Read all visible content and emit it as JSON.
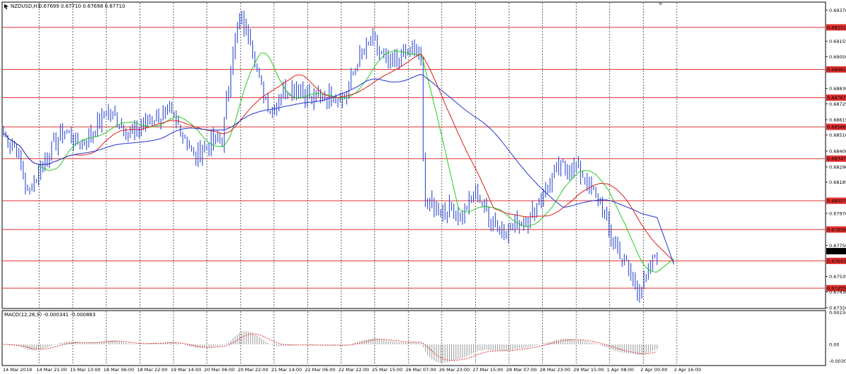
{
  "chart_header": {
    "symbol_timeframe": "NZDUSD,H1",
    "ohlc": "0.67699 0.67710 0.67698 0.67710",
    "icon": "chart-arrow-icon"
  },
  "macd_header": {
    "label": "MACD(12,26,9) -0.000341 -0.000883"
  },
  "colors": {
    "candles": "#2e4bd1",
    "ma_fast": "#22cc22",
    "ma_mid": "#e01b1b",
    "ma_slow": "#2233cc",
    "levels": "#e03030",
    "grid": "#000000",
    "macd_hist": "#9a9a9a",
    "macd_signal": "#e03030"
  },
  "chart_data": {
    "type": "line",
    "price_axis": {
      "ticks": [
        "0.69370",
        "0.69155",
        "0.69050",
        "0.68830",
        "0.68725",
        "0.68615",
        "0.68510",
        "0.68400",
        "0.68290",
        "0.68185",
        "0.67970",
        "0.67750",
        "0.67535",
        "0.67430",
        "0.67320"
      ],
      "ylim": [
        0.6732,
        0.6942
      ],
      "current_price": "0.67710"
    },
    "horizontal_levels": [
      "0.69251",
      "0.68961",
      "0.68767",
      "0.68566",
      "0.68347",
      "0.68057",
      "0.67859",
      "0.67643",
      "0.67455"
    ],
    "time_axis": [
      "14 Mar 2019",
      "14 Mar 21:00",
      "15 Mar 13:00",
      "18 Mar 06:00",
      "18 Mar 22:00",
      "19 Mar 14:00",
      "20 Mar 06:00",
      "20 Mar 22:00",
      "21 Mar 14:00",
      "22 Mar 06:00",
      "22 Mar 22:00",
      "25 Mar 15:00",
      "26 Mar 07:00",
      "26 Mar 23:00",
      "27 Mar 15:00",
      "28 Mar 07:00",
      "28 Mar 23:00",
      "29 Mar 15:00",
      "1 Apr 08:00",
      "2 Apr 00:00",
      "2 Apr 16:00"
    ],
    "price_anchors": [
      {
        "x": 0,
        "y": 0.6852
      },
      {
        "x": 0.02,
        "y": 0.684
      },
      {
        "x": 0.035,
        "y": 0.681
      },
      {
        "x": 0.05,
        "y": 0.6825
      },
      {
        "x": 0.07,
        "y": 0.6842
      },
      {
        "x": 0.09,
        "y": 0.6855
      },
      {
        "x": 0.11,
        "y": 0.6845
      },
      {
        "x": 0.13,
        "y": 0.6852
      },
      {
        "x": 0.15,
        "y": 0.6868
      },
      {
        "x": 0.17,
        "y": 0.686
      },
      {
        "x": 0.19,
        "y": 0.685
      },
      {
        "x": 0.21,
        "y": 0.6862
      },
      {
        "x": 0.24,
        "y": 0.6866
      },
      {
        "x": 0.26,
        "y": 0.6855
      },
      {
        "x": 0.28,
        "y": 0.6835
      },
      {
        "x": 0.3,
        "y": 0.6845
      },
      {
        "x": 0.32,
        "y": 0.6848
      },
      {
        "x": 0.335,
        "y": 0.691
      },
      {
        "x": 0.345,
        "y": 0.693
      },
      {
        "x": 0.36,
        "y": 0.692
      },
      {
        "x": 0.375,
        "y": 0.6885
      },
      {
        "x": 0.39,
        "y": 0.6868
      },
      {
        "x": 0.41,
        "y": 0.6882
      },
      {
        "x": 0.43,
        "y": 0.6885
      },
      {
        "x": 0.45,
        "y": 0.6875
      },
      {
        "x": 0.47,
        "y": 0.6878
      },
      {
        "x": 0.5,
        "y": 0.6878
      },
      {
        "x": 0.52,
        "y": 0.6905
      },
      {
        "x": 0.54,
        "y": 0.6915
      },
      {
        "x": 0.56,
        "y": 0.69
      },
      {
        "x": 0.58,
        "y": 0.6905
      },
      {
        "x": 0.6,
        "y": 0.691
      },
      {
        "x": 0.61,
        "y": 0.69
      },
      {
        "x": 0.615,
        "y": 0.6805
      },
      {
        "x": 0.63,
        "y": 0.68
      },
      {
        "x": 0.65,
        "y": 0.68
      },
      {
        "x": 0.67,
        "y": 0.6795
      },
      {
        "x": 0.69,
        "y": 0.6812
      },
      {
        "x": 0.71,
        "y": 0.6795
      },
      {
        "x": 0.73,
        "y": 0.6785
      },
      {
        "x": 0.75,
        "y": 0.679
      },
      {
        "x": 0.77,
        "y": 0.6795
      },
      {
        "x": 0.79,
        "y": 0.6812
      },
      {
        "x": 0.81,
        "y": 0.6828
      },
      {
        "x": 0.83,
        "y": 0.683
      },
      {
        "x": 0.85,
        "y": 0.6822
      },
      {
        "x": 0.87,
        "y": 0.6805
      },
      {
        "x": 0.89,
        "y": 0.6778
      },
      {
        "x": 0.91,
        "y": 0.6762
      },
      {
        "x": 0.925,
        "y": 0.6745
      },
      {
        "x": 0.935,
        "y": 0.6748
      },
      {
        "x": 0.945,
        "y": 0.6758
      },
      {
        "x": 0.955,
        "y": 0.6771
      },
      {
        "x": 1.0,
        "y": 0.6771
      }
    ],
    "ma_periods": [
      8,
      16,
      32
    ]
  }
}
